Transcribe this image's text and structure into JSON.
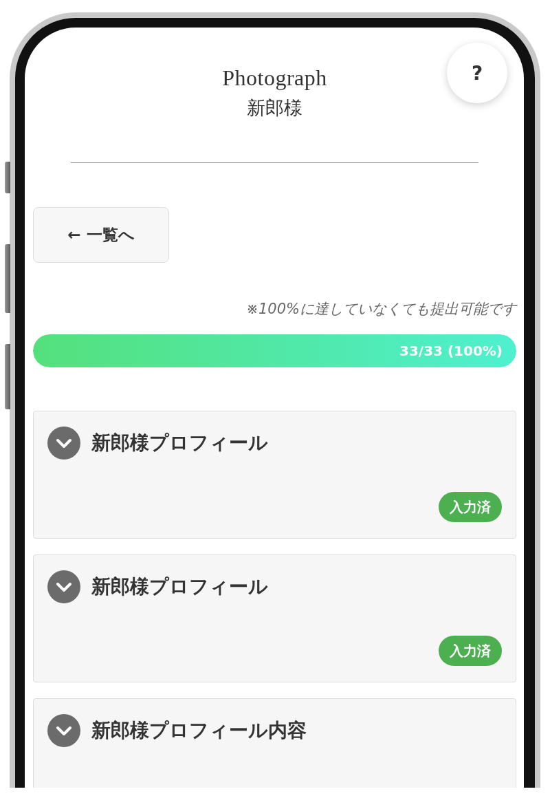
{
  "header": {
    "title": "Photograph",
    "subtitle": "新郎様"
  },
  "help_button": {
    "label": "?"
  },
  "back_button": {
    "label": "← 一覧へ"
  },
  "note": "※100%に達していなくても提出可能です",
  "progress": {
    "label": "33/33 (100%)"
  },
  "sections": [
    {
      "title": "新郎様プロフィール",
      "badge": "入力済"
    },
    {
      "title": "新郎様プロフィール",
      "badge": "入力済"
    },
    {
      "title": "新郎様プロフィール内容"
    }
  ]
}
